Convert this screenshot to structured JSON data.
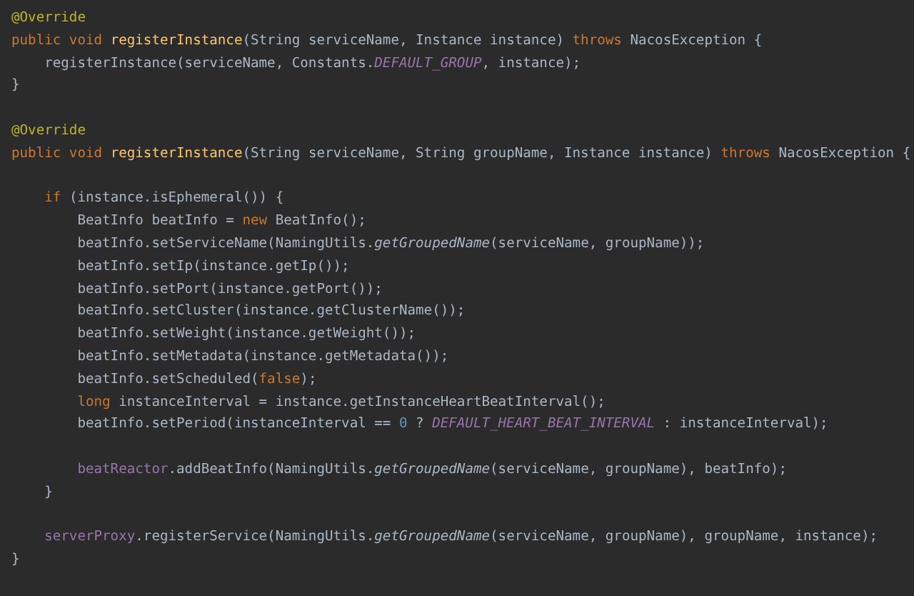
{
  "editor": {
    "lines": [
      {
        "kind": "code",
        "tokens": [
          {
            "kind": "ann",
            "text": "@Override"
          }
        ]
      },
      {
        "kind": "code",
        "tokens": [
          {
            "kind": "kw",
            "text": "public void "
          },
          {
            "kind": "decl",
            "text": "registerInstance"
          },
          {
            "kind": "plain",
            "text": "(String serviceName, Instance instance) "
          },
          {
            "kind": "kw",
            "text": "throws "
          },
          {
            "kind": "plain",
            "text": "NacosException {"
          }
        ]
      },
      {
        "kind": "code",
        "tokens": [
          {
            "kind": "plain",
            "text": "    registerInstance(serviceName, Constants."
          },
          {
            "kind": "const",
            "text": "DEFAULT_GROUP"
          },
          {
            "kind": "plain",
            "text": ", instance);"
          }
        ]
      },
      {
        "kind": "code",
        "tokens": [
          {
            "kind": "plain",
            "text": "}"
          }
        ]
      },
      {
        "kind": "blank"
      },
      {
        "kind": "code",
        "tokens": [
          {
            "kind": "ann",
            "text": "@Override"
          }
        ]
      },
      {
        "kind": "code",
        "tokens": [
          {
            "kind": "kw",
            "text": "public void "
          },
          {
            "kind": "decl",
            "text": "registerInstance"
          },
          {
            "kind": "plain",
            "text": "(String serviceName, String groupName, Instance instance) "
          },
          {
            "kind": "kw",
            "text": "throws "
          },
          {
            "kind": "plain",
            "text": "NacosException {"
          }
        ]
      },
      {
        "kind": "blank"
      },
      {
        "kind": "code",
        "tokens": [
          {
            "kind": "kw",
            "text": "    if "
          },
          {
            "kind": "plain",
            "text": "(instance.isEphemeral()) {"
          }
        ]
      },
      {
        "kind": "code",
        "tokens": [
          {
            "kind": "plain",
            "text": "        BeatInfo beatInfo = "
          },
          {
            "kind": "kw",
            "text": "new "
          },
          {
            "kind": "plain",
            "text": "BeatInfo();"
          }
        ]
      },
      {
        "kind": "code",
        "tokens": [
          {
            "kind": "plain",
            "text": "        beatInfo.setServiceName(NamingUtils."
          },
          {
            "kind": "static",
            "text": "getGroupedName"
          },
          {
            "kind": "plain",
            "text": "(serviceName, groupName));"
          }
        ]
      },
      {
        "kind": "code",
        "tokens": [
          {
            "kind": "plain",
            "text": "        beatInfo.setIp(instance.getIp());"
          }
        ]
      },
      {
        "kind": "code",
        "tokens": [
          {
            "kind": "plain",
            "text": "        beatInfo.setPort(instance.getPort());"
          }
        ]
      },
      {
        "kind": "code",
        "tokens": [
          {
            "kind": "plain",
            "text": "        beatInfo.setCluster(instance.getClusterName());"
          }
        ]
      },
      {
        "kind": "code",
        "tokens": [
          {
            "kind": "plain",
            "text": "        beatInfo.setWeight(instance.getWeight());"
          }
        ]
      },
      {
        "kind": "code",
        "tokens": [
          {
            "kind": "plain",
            "text": "        beatInfo.setMetadata(instance.getMetadata());"
          }
        ]
      },
      {
        "kind": "code",
        "tokens": [
          {
            "kind": "plain",
            "text": "        beatInfo.setScheduled("
          },
          {
            "kind": "kw",
            "text": "false"
          },
          {
            "kind": "plain",
            "text": ");"
          }
        ]
      },
      {
        "kind": "code",
        "tokens": [
          {
            "kind": "kw",
            "text": "        long "
          },
          {
            "kind": "plain",
            "text": "instanceInterval = instance.getInstanceHeartBeatInterval();"
          }
        ]
      },
      {
        "kind": "code",
        "tokens": [
          {
            "kind": "plain",
            "text": "        beatInfo.setPeriod(instanceInterval == "
          },
          {
            "kind": "num",
            "text": "0"
          },
          {
            "kind": "plain",
            "text": " ? "
          },
          {
            "kind": "const",
            "text": "DEFAULT_HEART_BEAT_INTERVAL"
          },
          {
            "kind": "plain",
            "text": " : instanceInterval);"
          }
        ]
      },
      {
        "kind": "blank"
      },
      {
        "kind": "code",
        "tokens": [
          {
            "kind": "field",
            "text": "        beatReactor"
          },
          {
            "kind": "plain",
            "text": ".addBeatInfo(NamingUtils."
          },
          {
            "kind": "static",
            "text": "getGroupedName"
          },
          {
            "kind": "plain",
            "text": "(serviceName, groupName), beatInfo);"
          }
        ]
      },
      {
        "kind": "code",
        "tokens": [
          {
            "kind": "plain",
            "text": "    }"
          }
        ]
      },
      {
        "kind": "blank"
      },
      {
        "kind": "code",
        "tokens": [
          {
            "kind": "field",
            "text": "    serverProxy"
          },
          {
            "kind": "plain",
            "text": ".registerService(NamingUtils."
          },
          {
            "kind": "static",
            "text": "getGroupedName"
          },
          {
            "kind": "plain",
            "text": "(serviceName, groupName), groupName, instance);"
          }
        ]
      },
      {
        "kind": "code",
        "tokens": [
          {
            "kind": "plain",
            "text": "}"
          }
        ]
      }
    ]
  }
}
